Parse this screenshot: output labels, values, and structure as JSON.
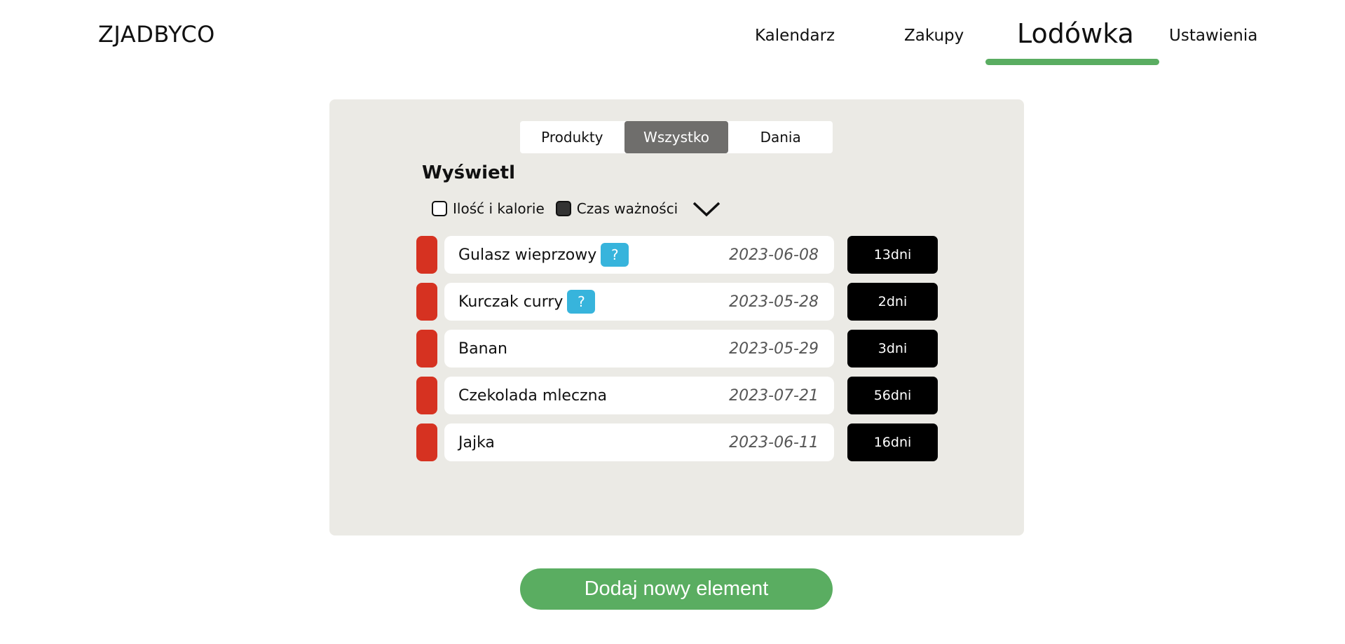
{
  "app": {
    "logo": "ZJADBYCO"
  },
  "nav": {
    "items": [
      {
        "label": "Kalendarz",
        "active": false
      },
      {
        "label": "Zakupy",
        "active": false
      },
      {
        "label": "Lodówka",
        "active": true
      },
      {
        "label": "Ustawienia",
        "active": false
      }
    ],
    "accent_color": "#5aad61"
  },
  "tabs": [
    {
      "label": "Produkty",
      "active": false
    },
    {
      "label": "Wszystko",
      "active": true
    },
    {
      "label": "Dania",
      "active": false
    }
  ],
  "display": {
    "title": "Wyświetl",
    "filters": [
      {
        "label": "Ilość i kalorie",
        "checked": false
      },
      {
        "label": "Czas ważności",
        "checked": true
      }
    ],
    "expand_icon": "chevron-down-icon"
  },
  "items": [
    {
      "name": "Gulasz wieprzowy",
      "help": "?",
      "date": "2023-06-08",
      "days": "13dni"
    },
    {
      "name": "Kurczak curry",
      "help": "?",
      "date": "2023-05-28",
      "days": "2dni"
    },
    {
      "name": "Banan",
      "help": null,
      "date": "2023-05-29",
      "days": "3dni"
    },
    {
      "name": "Czekolada mleczna",
      "help": null,
      "date": "2023-07-21",
      "days": "56dni"
    },
    {
      "name": "Jajka",
      "help": null,
      "date": "2023-06-11",
      "days": "16dni"
    }
  ],
  "colors": {
    "marker": "#d63221",
    "help_badge": "#37b4dc",
    "panel": "#ebeae5"
  },
  "add_button": {
    "label": "Dodaj nowy element"
  }
}
